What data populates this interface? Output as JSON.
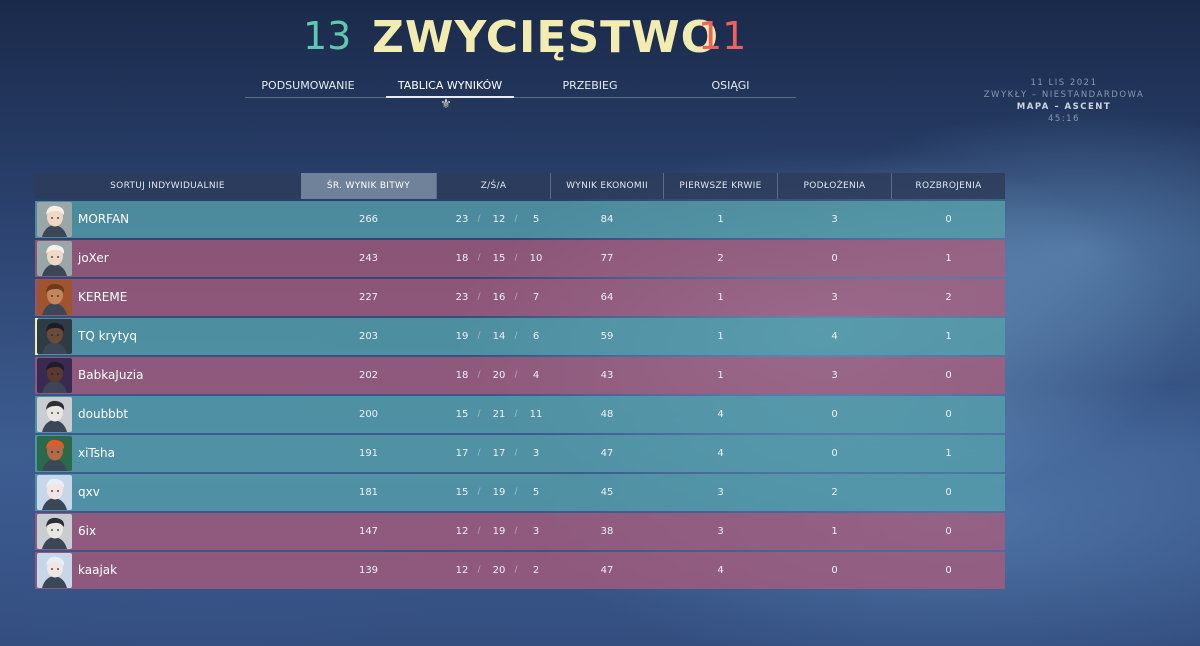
{
  "header": {
    "team_score": "13",
    "result": "ZWYCIĘSTWO",
    "enemy_score": "11"
  },
  "tabs": [
    {
      "label": "PODSUMOWANIE"
    },
    {
      "label": "TABLICA WYNIKÓW"
    },
    {
      "label": "PRZEBIEG"
    },
    {
      "label": "OSIĄGI"
    }
  ],
  "match_info": {
    "date": "11 LIS 2021",
    "mode": "ZWYKŁY – NIESTANDARDOWA",
    "map": "MAPA – ASCENT",
    "duration": "45:16"
  },
  "columns": {
    "sort": "SORTUJ INDYWIDUALNIE",
    "acs": "ŚR. WYNIK BITWY",
    "kda": "Z/Ś/A",
    "econ": "WYNIK EKONOMII",
    "first_bloods": "PIERWSZE KRWIE",
    "plants": "PODŁOŻENIA",
    "defuses": "ROZBROJENIA"
  },
  "players": [
    {
      "name": "MORFAN",
      "acs": "266",
      "k": "23",
      "d": "12",
      "a": "5",
      "econ": "84",
      "fb": "1",
      "plants": "3",
      "defuses": "0",
      "team": "a",
      "agent": "sova"
    },
    {
      "name": "joXer",
      "acs": "243",
      "k": "18",
      "d": "15",
      "a": "10",
      "econ": "77",
      "fb": "2",
      "plants": "0",
      "defuses": "1",
      "team": "b",
      "agent": "sova"
    },
    {
      "name": "KEREME",
      "acs": "227",
      "k": "23",
      "d": "16",
      "a": "7",
      "econ": "64",
      "fb": "1",
      "plants": "3",
      "defuses": "2",
      "team": "b",
      "agent": "breach"
    },
    {
      "name": "TQ krytyq",
      "acs": "203",
      "k": "19",
      "d": "14",
      "a": "6",
      "econ": "59",
      "fb": "1",
      "plants": "4",
      "defuses": "1",
      "team": "a",
      "agent": "chamber",
      "self": true
    },
    {
      "name": "BabkaJuzia",
      "acs": "202",
      "k": "18",
      "d": "20",
      "a": "4",
      "econ": "43",
      "fb": "1",
      "plants": "3",
      "defuses": "0",
      "team": "b",
      "agent": "astra"
    },
    {
      "name": "doubbbt",
      "acs": "200",
      "k": "15",
      "d": "21",
      "a": "11",
      "econ": "48",
      "fb": "4",
      "plants": "0",
      "defuses": "0",
      "team": "a",
      "agent": "cypher"
    },
    {
      "name": "xiTsha",
      "acs": "191",
      "k": "17",
      "d": "17",
      "a": "3",
      "econ": "47",
      "fb": "4",
      "plants": "0",
      "defuses": "1",
      "team": "a",
      "agent": "phoenix"
    },
    {
      "name": "qxv",
      "acs": "181",
      "k": "15",
      "d": "19",
      "a": "5",
      "econ": "45",
      "fb": "3",
      "plants": "2",
      "defuses": "0",
      "team": "a",
      "agent": "jett"
    },
    {
      "name": "6ix",
      "acs": "147",
      "k": "12",
      "d": "19",
      "a": "3",
      "econ": "38",
      "fb": "3",
      "plants": "1",
      "defuses": "0",
      "team": "b",
      "agent": "cypher"
    },
    {
      "name": "kaajak",
      "acs": "139",
      "k": "12",
      "d": "20",
      "a": "2",
      "econ": "47",
      "fb": "4",
      "plants": "0",
      "defuses": "0",
      "team": "b",
      "agent": "jett"
    }
  ],
  "colors": {
    "team_a_row": "#56a0aa",
    "team_b_row": "#b05c78",
    "win_title": "#f2ecb0",
    "team_score": "#5ec9b0",
    "enemy_score": "#f25f5c"
  }
}
